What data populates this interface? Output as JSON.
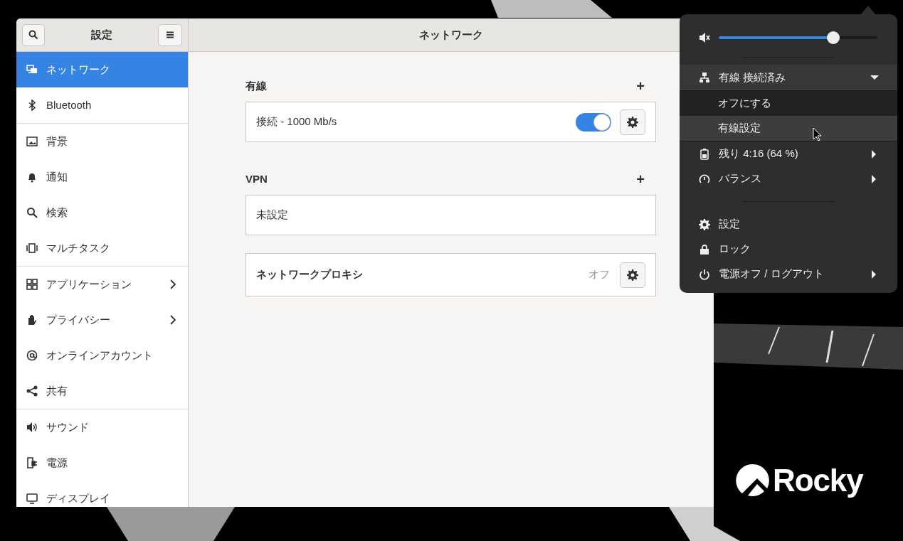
{
  "window": {
    "sidebar_title": "設定",
    "title": "ネットワーク"
  },
  "sidebar": {
    "groups": [
      [
        {
          "label": "ネットワーク",
          "selected": true,
          "submenu": false
        },
        {
          "label": "Bluetooth",
          "selected": false,
          "submenu": false
        }
      ],
      [
        {
          "label": "背景",
          "selected": false,
          "submenu": false
        },
        {
          "label": "通知",
          "selected": false,
          "submenu": false
        },
        {
          "label": "検索",
          "selected": false,
          "submenu": false
        },
        {
          "label": "マルチタスク",
          "selected": false,
          "submenu": false
        }
      ],
      [
        {
          "label": "アプリケーション",
          "selected": false,
          "submenu": true
        },
        {
          "label": "プライバシー",
          "selected": false,
          "submenu": true
        },
        {
          "label": "オンラインアカウント",
          "selected": false,
          "submenu": false
        },
        {
          "label": "共有",
          "selected": false,
          "submenu": false
        }
      ],
      [
        {
          "label": "サウンド",
          "selected": false,
          "submenu": false
        },
        {
          "label": "電源",
          "selected": false,
          "submenu": false
        },
        {
          "label": "ディスプレイ",
          "selected": false,
          "submenu": false
        }
      ]
    ]
  },
  "sections": [
    {
      "title": "有線",
      "add": "+",
      "rows": [
        {
          "kind": "connection",
          "label": "接続 - 1000 Mb/s",
          "on": true
        }
      ]
    },
    {
      "title": "VPN",
      "add": "+",
      "rows": [
        {
          "kind": "empty",
          "label": "未設定"
        }
      ]
    }
  ],
  "proxy": {
    "label": "ネットワークプロキシ",
    "status": "オフ"
  },
  "system_menu": {
    "volume": {
      "level": 0.72
    },
    "network": {
      "label": "有線 接続済み",
      "expanded": true,
      "items": [
        {
          "label": "オフにする",
          "selected": false
        },
        {
          "label": "有線設定",
          "selected": true
        }
      ]
    },
    "groups": [
      [
        {
          "label": "残り 4:16 (64 %)",
          "submenu": true
        },
        {
          "label": "バランス",
          "submenu": true
        }
      ],
      [
        {
          "label": "設定",
          "submenu": false
        },
        {
          "label": "ロック",
          "submenu": false
        },
        {
          "label": "電源オフ / ログアウト",
          "submenu": true
        }
      ]
    ]
  },
  "wallpaper_logo": "Rocky"
}
